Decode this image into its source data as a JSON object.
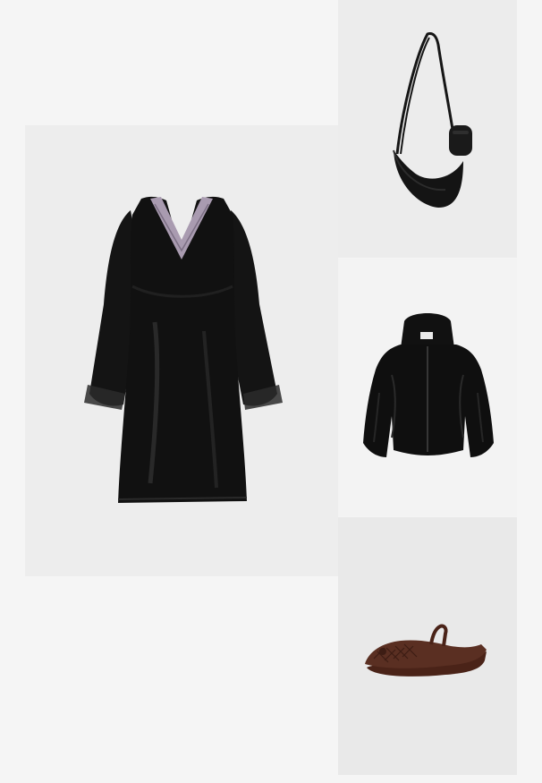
{
  "products": [
    {
      "kind": "dress",
      "icon": "satin-lace-dress-image",
      "bg": "#ededed"
    },
    {
      "kind": "bag",
      "icon": "crescent-crossbody-bag-image",
      "bg": "#ececec"
    },
    {
      "kind": "jacket",
      "icon": "faux-fur-hooded-jacket-image",
      "bg": "#f3f3f3"
    },
    {
      "kind": "shoe",
      "icon": "ballet-flat-shoe-image",
      "bg": "#e9e9e9"
    }
  ],
  "colors": {
    "page_bg": "#f5f5f5",
    "black_item": "#161616",
    "lace": "#a99bb0",
    "shoe_brown": "#5a2f22"
  }
}
